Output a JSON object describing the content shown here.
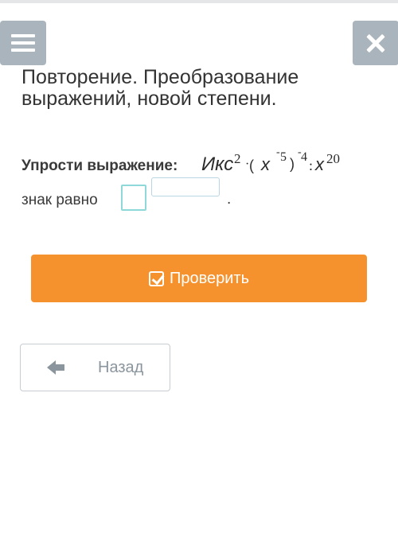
{
  "header": {
    "menu_icon": "menu-icon",
    "close_icon": "close-icon",
    "title": "Повторение. Преобразование\nвыражений, новой степени."
  },
  "task": {
    "label": "Упрости выражение:",
    "expression": {
      "base": "Икс",
      "exp1": "2",
      "dot": "·",
      "open_paren": "(",
      "x1": "x",
      "neg1": "-",
      "exp2": "5",
      "close_paren": ")",
      "neg2": "-",
      "exp3": "4",
      "colon": ":",
      "x2": "x",
      "exp4": "20"
    }
  },
  "answer": {
    "label": "знак равно",
    "base_value": "",
    "exponent_value": "",
    "trailing": "."
  },
  "actions": {
    "check_label": "Проверить",
    "check_icon": "checkbox-icon",
    "back_label": "Назад",
    "back_icon": "arrow-left-icon"
  },
  "colors": {
    "accent": "#f6922d",
    "header_button": "#a9b4bc",
    "input_border": "#8fd8d9",
    "back_text": "#8a959d"
  }
}
